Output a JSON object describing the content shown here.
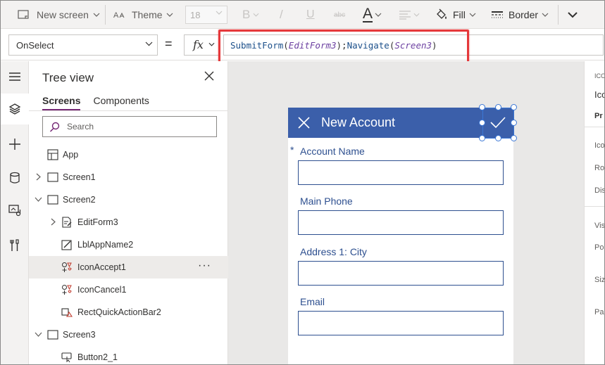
{
  "toolbar": {
    "new_screen_label": "New screen",
    "theme_label": "Theme",
    "font_size_value": "18",
    "bold_label": "B",
    "italic_label": "/",
    "underline_label": "U",
    "strike_label": "abc",
    "font_color_label": "A",
    "fill_label": "Fill",
    "border_label": "Border"
  },
  "formula_bar": {
    "property": "OnSelect",
    "equals": "=",
    "fx_label": "fx",
    "formula_tokens": {
      "fn1": "SubmitForm",
      "open1": "(",
      "arg1": "EditForm3",
      "close1": ");",
      "fn2": "Navigate",
      "open2": "(",
      "arg2": "Screen3",
      "close2": ")"
    }
  },
  "rail": {
    "icons": [
      "hamburger-icon",
      "layers-icon",
      "plus-icon",
      "database-icon",
      "media-icon",
      "tools-icon"
    ]
  },
  "tree_view": {
    "title": "Tree view",
    "tabs": [
      {
        "label": "Screens",
        "active": true
      },
      {
        "label": "Components",
        "active": false
      }
    ],
    "search_placeholder": "Search",
    "items": [
      {
        "label": "App",
        "icon": "app-icon",
        "level": 0,
        "expander": "none"
      },
      {
        "label": "Screen1",
        "icon": "screen-icon",
        "level": 0,
        "expander": "collapsed"
      },
      {
        "label": "Screen2",
        "icon": "screen-icon",
        "level": 0,
        "expander": "expanded"
      },
      {
        "label": "EditForm3",
        "icon": "form-icon",
        "level": 1,
        "expander": "collapsed"
      },
      {
        "label": "LblAppName2",
        "icon": "label-icon",
        "level": 1,
        "expander": "none"
      },
      {
        "label": "IconAccept1",
        "icon": "shapes-icon",
        "level": 1,
        "expander": "none",
        "selected": true
      },
      {
        "label": "IconCancel1",
        "icon": "shapes-icon",
        "level": 1,
        "expander": "none"
      },
      {
        "label": "RectQuickActionBar2",
        "icon": "rectangle-icon",
        "level": 1,
        "expander": "none"
      },
      {
        "label": "Screen3",
        "icon": "screen-icon",
        "level": 0,
        "expander": "expanded"
      },
      {
        "label": "Button2_1",
        "icon": "button-icon",
        "level": 1,
        "expander": "none"
      }
    ],
    "more_label": "···"
  },
  "canvas": {
    "screen_title": "New Account",
    "required_mark": "*",
    "fields": [
      {
        "label": "Account Name",
        "required": true,
        "value": ""
      },
      {
        "label": "Main Phone",
        "required": false,
        "value": ""
      },
      {
        "label": "Address 1: City",
        "required": false,
        "value": ""
      },
      {
        "label": "Email",
        "required": false,
        "value": ""
      }
    ]
  },
  "properties_panel": {
    "labels": [
      "ICO",
      "Ico",
      "Pr",
      "Ico",
      "Ro",
      "Dis",
      "Vis",
      "Po",
      "Siz",
      "Pa"
    ]
  },
  "colors": {
    "header_blue": "#3b5faa",
    "field_border": "#2d4f8f",
    "tab_accent": "#742774",
    "highlight_red": "#e5383b",
    "selection_blue": "#3b77d6"
  }
}
